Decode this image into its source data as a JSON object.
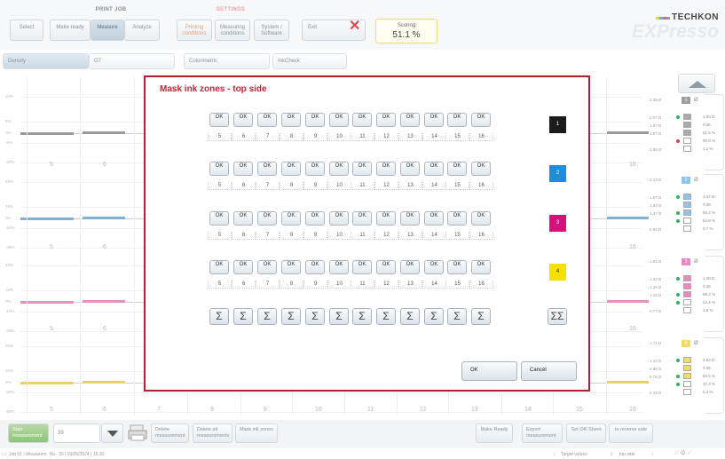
{
  "toolbar": {
    "print_job_label": "PRINT JOB",
    "settings_label": "SETTINGS",
    "tabs": [
      {
        "label": "Select"
      },
      {
        "label": "Make ready"
      },
      {
        "label": "Measure"
      },
      {
        "label": "Analyze"
      },
      {
        "label": "Printing conditions"
      },
      {
        "label": "Measuring conditions"
      },
      {
        "label": "System / Software"
      }
    ],
    "exit_label": "Exit",
    "scoring_label": "Scoring",
    "scoring_value": "51.1 %"
  },
  "logo": {
    "brand": "TECHKON",
    "product": "EXPresso"
  },
  "subtabs": [
    {
      "label": "Density"
    },
    {
      "label": "G7"
    },
    {
      "label": "Colorimetric"
    },
    {
      "label": "InkCheck"
    }
  ],
  "chart": {
    "zone_labels": [
      "5",
      "6",
      "7",
      "8",
      "9",
      "10",
      "11",
      "12",
      "13",
      "14",
      "15",
      "16"
    ],
    "panels": [
      {
        "ticks": [
          "20%",
          "5%",
          "0%",
          "-5%",
          "-20%"
        ],
        "color": "#9a9a9a"
      },
      {
        "ticks": [
          "40%",
          "15%",
          "0%",
          "-10%",
          "-40%"
        ],
        "color": "#7fb0d8"
      },
      {
        "ticks": [
          "40%",
          "15%",
          "0%",
          "-10%",
          "-40%"
        ],
        "color": "#e690bd"
      },
      {
        "ticks": [
          "30%",
          "10%",
          "0%",
          "-20%",
          "-60%"
        ],
        "color": "#e8d06a"
      }
    ]
  },
  "right_panel": {
    "groups": [
      {
        "number": "1",
        "head_color": "#9e9e9e",
        "vals": [
          "2.38 D",
          "2.07 D",
          "1.97 D",
          "1.97 D",
          "1.58 D"
        ],
        "texts": [
          "2.00 D",
          "0.46",
          "51.5 %",
          "50.8 %",
          "1.1 %"
        ],
        "swatch": "#aaaaaa"
      },
      {
        "number": "2",
        "head_color": "#8fc3ea",
        "vals": [
          "2.13 D",
          "1.67 D",
          "1.52 D",
          "1.37 D",
          "0.91 D"
        ],
        "texts": [
          "1.47 D",
          "0.39",
          "56.2 %",
          "54.9 %",
          "0.7 %"
        ],
        "swatch": "#8fc3ea"
      },
      {
        "number": "3",
        "head_color": "#ee86c4",
        "vals": [
          "1.81 D",
          "1.42 D",
          "1.29 D",
          "1.16 D",
          "0.77 D"
        ],
        "texts": [
          "1.28 D",
          "0.36",
          "69.3 %",
          "53.4 %",
          "1.9 %"
        ],
        "swatch": "#ee86c4"
      },
      {
        "number": "4",
        "head_color": "#f3dc62",
        "vals": [
          "1.71 D",
          "1.14 D",
          "0.95 D",
          "0.76 D",
          "0.19 D"
        ],
        "texts": [
          "0.92 D",
          "0.35",
          "84.5 %",
          "37.4 %",
          "5.3 %"
        ],
        "swatch": "#f3dc62"
      }
    ],
    "avg_symbol": "Ø"
  },
  "bottom": {
    "start_label": "Start measurement",
    "count_value": "39",
    "delete_label": "Delete measurement",
    "delete_all_label": "Delete all measurements",
    "mask_label": "Mask ink zones",
    "make_ready_label": "Make Ready",
    "export_label": "Export measurement",
    "ok_sheet_label": "Set OK-Sheet",
    "reverse_label": "to reverse side"
  },
  "status": {
    "left": "Job 01  |  Measurem. No.: 39  |  03/05/2024  |  15:30",
    "target": "Target values",
    "side": "top side"
  },
  "dialog": {
    "title": "Mask ink zones - top side",
    "zones": [
      "5",
      "6",
      "7",
      "8",
      "9",
      "10",
      "11",
      "12",
      "13",
      "14",
      "15",
      "16"
    ],
    "ok_text": "OK",
    "sigma": "Σ",
    "sigma_all": "ΣΣ",
    "inks": [
      {
        "label": "1",
        "color": "#1b1b1b",
        "text_color": "#ffffff"
      },
      {
        "label": "2",
        "color": "#1e8fd6",
        "text_color": "#ffffff"
      },
      {
        "label": "3",
        "color": "#d6117c",
        "text_color": "#ffffff"
      },
      {
        "label": "4",
        "color": "#f4e100",
        "text_color": "#222222"
      }
    ],
    "ok_button": "OK",
    "cancel_button": "Cancel"
  }
}
